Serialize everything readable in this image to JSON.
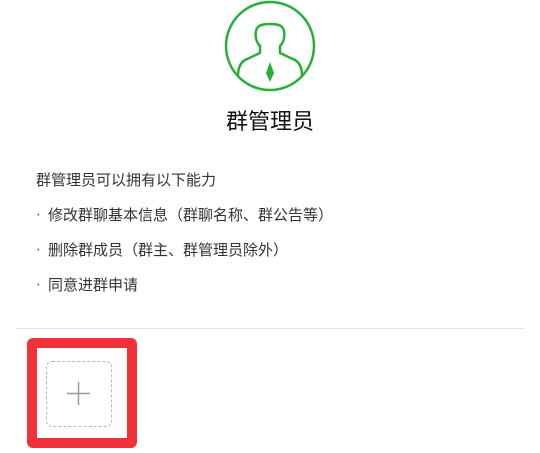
{
  "page": {
    "title": "群管理员"
  },
  "avatar": {
    "icon": "admin-person-icon",
    "color": "#2aae3a"
  },
  "description": {
    "heading": "群管理员可以拥有以下能力",
    "bullet": "·",
    "items": [
      "修改群聊基本信息（群聊名称、群公告等）",
      "删除群成员（群主、群管理员除外）",
      "同意进群申请"
    ]
  },
  "add_button": {
    "icon": "plus-icon",
    "highlight_color": "#f0313a"
  }
}
